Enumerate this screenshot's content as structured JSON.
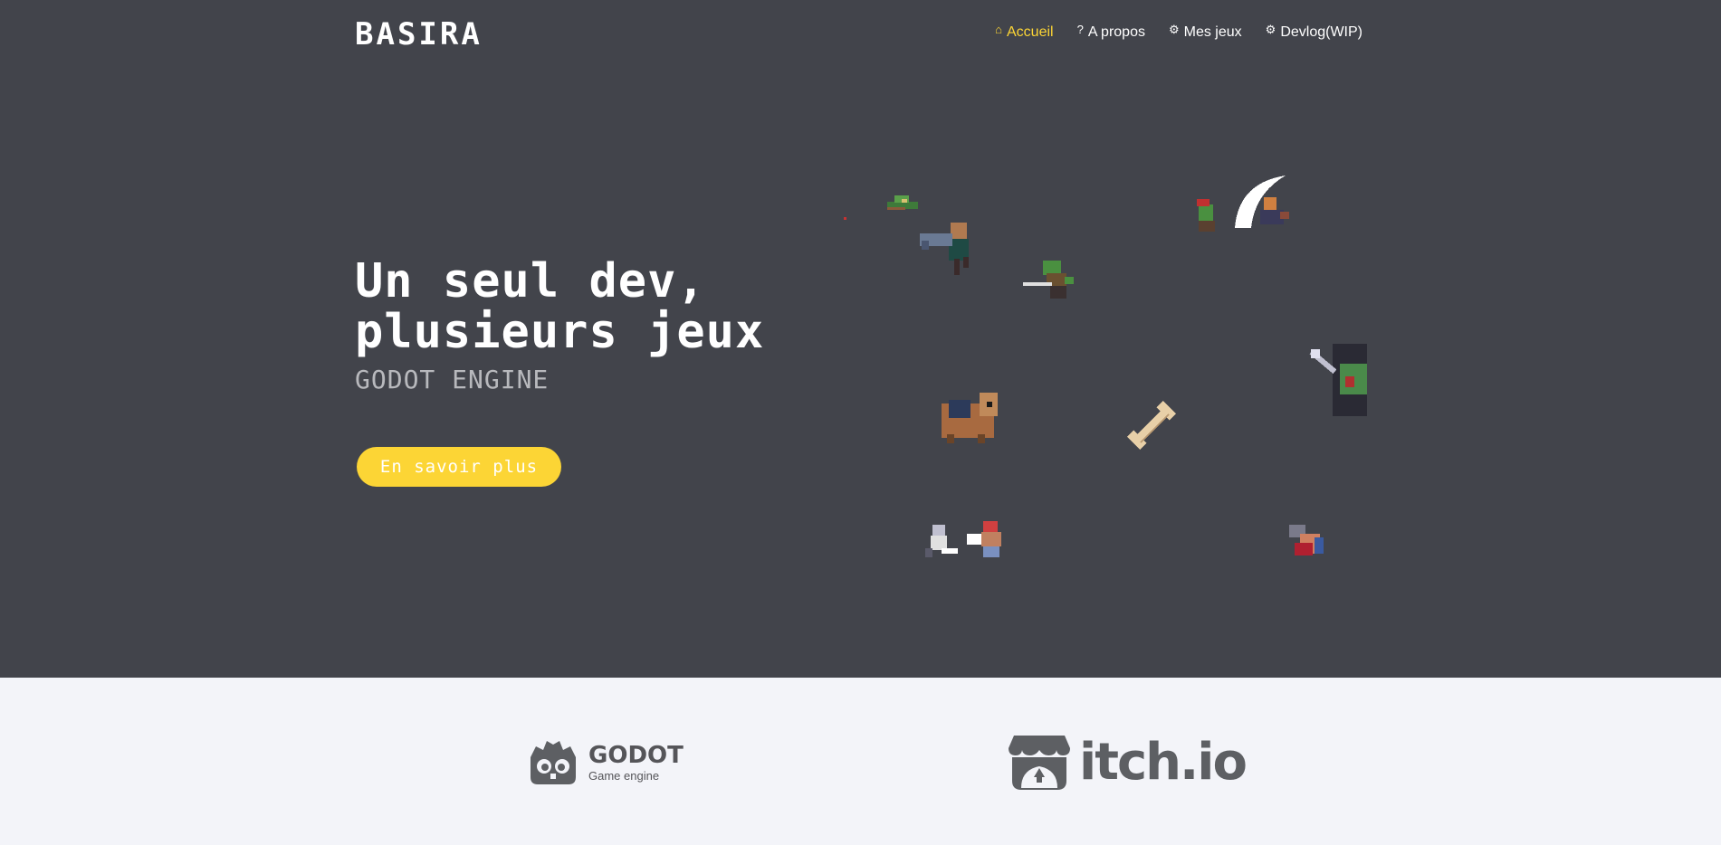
{
  "header": {
    "logo": "BASIRA",
    "nav": [
      {
        "label": "Accueil",
        "icon": "home-icon",
        "active": true
      },
      {
        "label": "A propos",
        "icon": "question-icon",
        "active": false
      },
      {
        "label": "Mes jeux",
        "icon": "gear-icon",
        "active": false
      },
      {
        "label": "Devlog(WIP)",
        "icon": "gear-icon",
        "active": false
      }
    ]
  },
  "hero": {
    "headline_line1": "Un seul dev,",
    "headline_line2": "plusieurs jeux",
    "subheadline": "GODOT ENGINE",
    "cta_label": "En savoir plus"
  },
  "partners": {
    "godot": {
      "title": "GODOT",
      "subtitle": "Game engine",
      "icon": "godot-logo-icon"
    },
    "itch": {
      "title": "itch.io",
      "icon": "itch-logo-icon"
    }
  },
  "colors": {
    "accent": "#fcd535",
    "hero_bg": "#42444b",
    "footer_bg": "#f3f4f9"
  }
}
